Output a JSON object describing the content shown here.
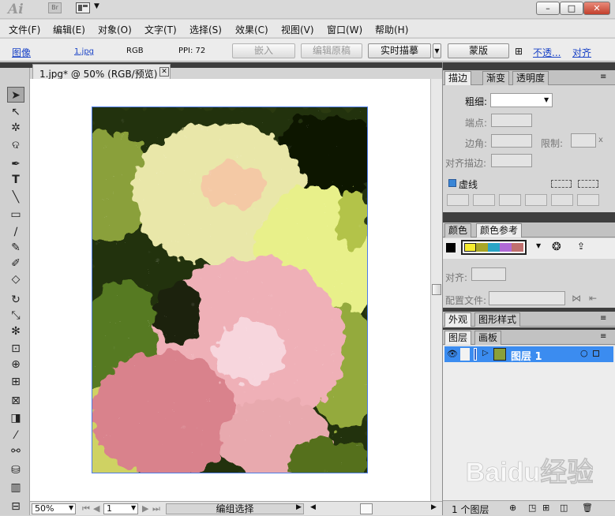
{
  "app": {
    "logo": "Ai",
    "bridge": "Br"
  },
  "window_controls": {
    "minimize": "–",
    "restore": "□",
    "close": "✕"
  },
  "menu": [
    "文件(F)",
    "编辑(E)",
    "对象(O)",
    "文字(T)",
    "选择(S)",
    "效果(C)",
    "视图(V)",
    "窗口(W)",
    "帮助(H)"
  ],
  "control_bar": {
    "image_label": "图像",
    "file_name": "1.jpg",
    "color_mode": "RGB",
    "ppi": "PPI: 72",
    "embed": "嵌入",
    "edit_original": "编辑原稿",
    "live_trace": "实时描摹",
    "mask": "蒙版",
    "opacity_link": "不透...",
    "align_link": "对齐"
  },
  "document": {
    "tab_title": "1.jpg* @ 50% (RGB/预览)",
    "zoom": "50%",
    "page": "1",
    "status": "编组选择"
  },
  "stroke_panel": {
    "tabs": [
      "描边",
      "渐变",
      "透明度"
    ],
    "weight_label": "粗细:",
    "cap_label": "端点:",
    "corner_label": "边角:",
    "limit_label": "限制:",
    "limit_unit": "x",
    "align_label": "对齐描边:",
    "dashed_label": "虚线"
  },
  "color_panel": {
    "tabs": [
      "颜色",
      "颜色参考"
    ],
    "swatches": [
      "#f6ec2e",
      "#a8a627",
      "#2aa5c6",
      "#b06ad6",
      "#c0706f"
    ]
  },
  "align_panel": {
    "align_label": "对齐:",
    "profile_label": "配置文件:"
  },
  "appearance_panel": {
    "tabs": [
      "外观",
      "图形样式"
    ]
  },
  "layers_panel": {
    "tabs": [
      "图层",
      "画板"
    ],
    "layer_name": "图层 1",
    "count": "1 个图层"
  },
  "watermark": {
    "text": "Baidu经验"
  }
}
